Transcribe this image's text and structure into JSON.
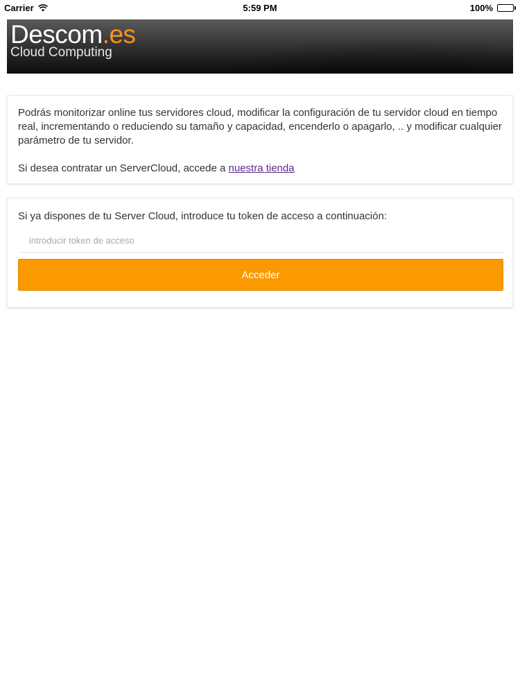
{
  "status_bar": {
    "carrier": "Carrier",
    "time": "5:59 PM",
    "battery": "100%",
    "icons": [
      "wifi-icon",
      "battery-icon"
    ]
  },
  "header": {
    "brand_main": "Descom",
    "brand_tld": ".es",
    "tagline": "Cloud Computing",
    "accent_color": "#f7941d"
  },
  "info_card": {
    "text": "Podrás monitorizar online tus servidores cloud, modificar la configuración de tu servidor cloud en tiempo real, incrementando o reduciendo su tamaño y capacidad, encenderlo o apagarlo, .. y modificar cualquier parámetro de tu servidor.",
    "contract_prefix": "Si desea contratar un ServerCloud, accede a ",
    "store_link": "nuestra tienda",
    "link_color": "#5b2a86"
  },
  "access_card": {
    "label": "Si ya dispones de tu Server Cloud, introduce tu token de acceso a continuación:",
    "token_placeholder": "introducir token de acceso",
    "token_value": "",
    "button_label": "Acceder",
    "button_color": "#fb9901"
  }
}
